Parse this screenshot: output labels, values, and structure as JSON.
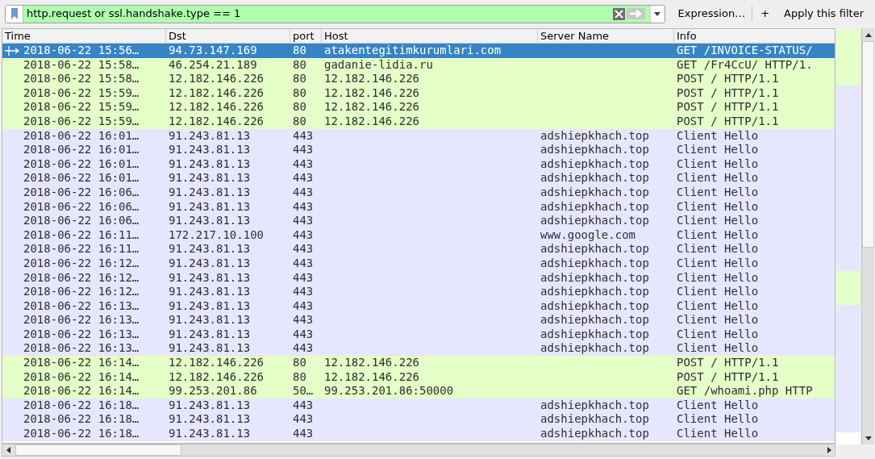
{
  "filter_bar": {
    "value": "http.request or ssl.handshake.type == 1",
    "buttons": [
      "Expression…",
      "+",
      "Apply this filter"
    ]
  },
  "table": {
    "columns": [
      "Time",
      "Dst",
      "port",
      "Host",
      "Server Name",
      "Info"
    ],
    "rows": [
      {
        "kind": "http",
        "selected": true,
        "cells": [
          "2018-06-22 15:56…",
          "94.73.147.169",
          "80",
          "atakentegitimkurumlari.com",
          "",
          "GET /INVOICE-STATUS/"
        ]
      },
      {
        "kind": "http",
        "selected": false,
        "cells": [
          "2018-06-22 15:58…",
          "46.254.21.189",
          "80",
          "gadanie-lidia.ru",
          "",
          "GET /Fr4CcU/ HTTP/1."
        ]
      },
      {
        "kind": "http",
        "selected": false,
        "cells": [
          "2018-06-22 15:58…",
          "12.182.146.226",
          "80",
          "12.182.146.226",
          "",
          "POST / HTTP/1.1"
        ]
      },
      {
        "kind": "http",
        "selected": false,
        "cells": [
          "2018-06-22 15:59…",
          "12.182.146.226",
          "80",
          "12.182.146.226",
          "",
          "POST / HTTP/1.1"
        ]
      },
      {
        "kind": "http",
        "selected": false,
        "cells": [
          "2018-06-22 15:59…",
          "12.182.146.226",
          "80",
          "12.182.146.226",
          "",
          "POST / HTTP/1.1"
        ]
      },
      {
        "kind": "http",
        "selected": false,
        "cells": [
          "2018-06-22 15:59…",
          "12.182.146.226",
          "80",
          "12.182.146.226",
          "",
          "POST / HTTP/1.1"
        ]
      },
      {
        "kind": "tls",
        "selected": false,
        "cells": [
          "2018-06-22 16:01…",
          "91.243.81.13",
          "443",
          "",
          "adshiepkhach.top",
          "Client Hello"
        ]
      },
      {
        "kind": "tls",
        "selected": false,
        "cells": [
          "2018-06-22 16:01…",
          "91.243.81.13",
          "443",
          "",
          "adshiepkhach.top",
          "Client Hello"
        ]
      },
      {
        "kind": "tls",
        "selected": false,
        "cells": [
          "2018-06-22 16:01…",
          "91.243.81.13",
          "443",
          "",
          "adshiepkhach.top",
          "Client Hello"
        ]
      },
      {
        "kind": "tls",
        "selected": false,
        "cells": [
          "2018-06-22 16:01…",
          "91.243.81.13",
          "443",
          "",
          "adshiepkhach.top",
          "Client Hello"
        ]
      },
      {
        "kind": "tls",
        "selected": false,
        "cells": [
          "2018-06-22 16:06…",
          "91.243.81.13",
          "443",
          "",
          "adshiepkhach.top",
          "Client Hello"
        ]
      },
      {
        "kind": "tls",
        "selected": false,
        "cells": [
          "2018-06-22 16:06…",
          "91.243.81.13",
          "443",
          "",
          "adshiepkhach.top",
          "Client Hello"
        ]
      },
      {
        "kind": "tls",
        "selected": false,
        "cells": [
          "2018-06-22 16:06…",
          "91.243.81.13",
          "443",
          "",
          "adshiepkhach.top",
          "Client Hello"
        ]
      },
      {
        "kind": "tls",
        "selected": false,
        "cells": [
          "2018-06-22 16:11…",
          "172.217.10.100",
          "443",
          "",
          "www.google.com",
          "Client Hello"
        ]
      },
      {
        "kind": "tls",
        "selected": false,
        "cells": [
          "2018-06-22 16:11…",
          "91.243.81.13",
          "443",
          "",
          "adshiepkhach.top",
          "Client Hello"
        ]
      },
      {
        "kind": "tls",
        "selected": false,
        "cells": [
          "2018-06-22 16:12…",
          "91.243.81.13",
          "443",
          "",
          "adshiepkhach.top",
          "Client Hello"
        ]
      },
      {
        "kind": "tls",
        "selected": false,
        "cells": [
          "2018-06-22 16:12…",
          "91.243.81.13",
          "443",
          "",
          "adshiepkhach.top",
          "Client Hello"
        ]
      },
      {
        "kind": "tls",
        "selected": false,
        "cells": [
          "2018-06-22 16:12…",
          "91.243.81.13",
          "443",
          "",
          "adshiepkhach.top",
          "Client Hello"
        ]
      },
      {
        "kind": "tls",
        "selected": false,
        "cells": [
          "2018-06-22 16:13…",
          "91.243.81.13",
          "443",
          "",
          "adshiepkhach.top",
          "Client Hello"
        ]
      },
      {
        "kind": "tls",
        "selected": false,
        "cells": [
          "2018-06-22 16:13…",
          "91.243.81.13",
          "443",
          "",
          "adshiepkhach.top",
          "Client Hello"
        ]
      },
      {
        "kind": "tls",
        "selected": false,
        "cells": [
          "2018-06-22 16:13…",
          "91.243.81.13",
          "443",
          "",
          "adshiepkhach.top",
          "Client Hello"
        ]
      },
      {
        "kind": "tls",
        "selected": false,
        "cells": [
          "2018-06-22 16:13…",
          "91.243.81.13",
          "443",
          "",
          "adshiepkhach.top",
          "Client Hello"
        ]
      },
      {
        "kind": "http",
        "selected": false,
        "cells": [
          "2018-06-22 16:14…",
          "12.182.146.226",
          "80",
          "12.182.146.226",
          "",
          "POST / HTTP/1.1"
        ]
      },
      {
        "kind": "http",
        "selected": false,
        "cells": [
          "2018-06-22 16:14…",
          "12.182.146.226",
          "80",
          "12.182.146.226",
          "",
          "POST / HTTP/1.1"
        ]
      },
      {
        "kind": "http",
        "selected": false,
        "cells": [
          "2018-06-22 16:14…",
          "99.253.201.86",
          "50…",
          "99.253.201.86:50000",
          "",
          "GET /whoami.php HTTP"
        ]
      },
      {
        "kind": "tls",
        "selected": false,
        "cells": [
          "2018-06-22 16:18…",
          "91.243.81.13",
          "443",
          "",
          "adshiepkhach.top",
          "Client Hello"
        ]
      },
      {
        "kind": "tls",
        "selected": false,
        "cells": [
          "2018-06-22 16:18…",
          "91.243.81.13",
          "443",
          "",
          "adshiepkhach.top",
          "Client Hello"
        ]
      },
      {
        "kind": "tls",
        "selected": false,
        "cells": [
          "2018-06-22 16:18…",
          "91.243.81.13",
          "443",
          "",
          "adshiepkhach.top",
          "Client Hello"
        ]
      }
    ]
  }
}
